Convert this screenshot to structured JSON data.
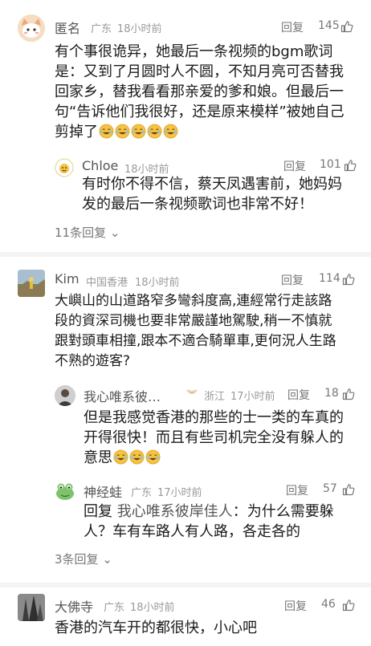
{
  "comments": [
    {
      "name": "匿名",
      "location": "广东",
      "time": "18小时前",
      "reply_label": "回复",
      "likes": "145",
      "text_lines": [
        "有个事很诡异，她最后一条视频的bgm歌词",
        "是：又到了月圆时人不圆，不知月亮可否替我",
        "回家乡，替我看看那亲爱的爹和娘。但最后一",
        "句“告诉他们我很好，还是原来模样”被她自己",
        "剪掉了"
      ],
      "emoji_count": 5,
      "replies": [
        {
          "name": "Chloe",
          "time": "18小时前",
          "reply_label": "回复",
          "likes": "101",
          "text_lines": [
            "有时你不得不信，蔡天凤遇害前，她妈妈",
            "发的最后一条视频歌词也非常不好！"
          ]
        }
      ],
      "more_replies": "11条回复"
    },
    {
      "name": "Kim",
      "location": "中国香港",
      "time": "18小时前",
      "reply_label": "回复",
      "likes": "114",
      "text_lines": [
        "大嶼山的山道路窄多彎斜度高,連經常行走該路",
        "段的資深司機也要非常嚴謹地駕駛,稍一不慎就",
        "跟對頭車相撞,跟本不適合騎單車,更何況人生路",
        "不熟的遊客?"
      ],
      "replies": [
        {
          "name": "我心唯系彼…",
          "location": "浙江",
          "time": "17小时前",
          "reply_label": "回复",
          "likes": "18",
          "text_lines": [
            "但是我感觉香港的那些的士一类的车真的",
            "开得很快！而且有些司机完全没有躲人的",
            "意思"
          ],
          "emoji_count": 3
        },
        {
          "name": "神经蛙",
          "location": "广东",
          "time": "17小时前",
          "reply_label": "回复",
          "likes": "57",
          "reply_prefix": "回复",
          "reply_to": "我心唯系彼岸佳人",
          "text_lines": [
            "：为什么需要躲",
            "人？车有车路人有人路，各走各的"
          ]
        }
      ],
      "more_replies": "3条回复"
    },
    {
      "name": "大佛寺",
      "location": "广东",
      "time": "18小时前",
      "reply_label": "回复",
      "likes": "46",
      "text_lines": [
        "香港的汽车开的都很快，小心吧"
      ]
    }
  ],
  "colors": {
    "text": "#1a1a1a",
    "meta": "#9a9a9a",
    "divider": "#f4f4f4",
    "emoji": "#f5c242"
  }
}
